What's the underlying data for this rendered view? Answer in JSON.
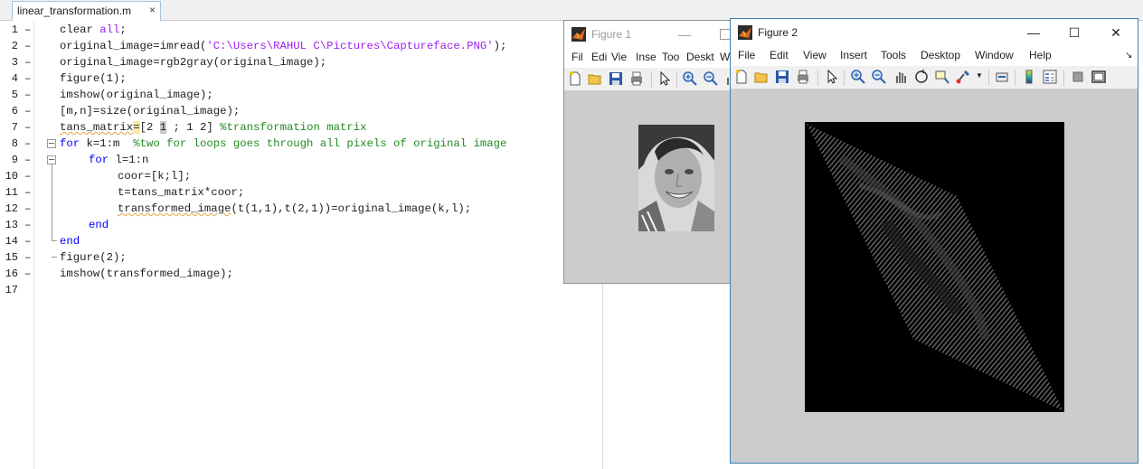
{
  "editor": {
    "tab_label": "linear_transformation.m",
    "tab_close": "×",
    "line_numbers": [
      "1",
      "2",
      "3",
      "4",
      "5",
      "6",
      "7",
      "8",
      "9",
      "10",
      "11",
      "12",
      "13",
      "14",
      "15",
      "16",
      "17"
    ],
    "dash": "–",
    "lines": {
      "l1_a": "clear ",
      "l1_b": "all",
      "l1_c": ";",
      "l2_a": "original_image=imread(",
      "l2_b": "'C:\\Users\\RAHUL C\\Pictures\\Captureface.PNG'",
      "l2_c": ");",
      "l3": "original_image=rgb2gray(original_image);",
      "l4": "figure(1);",
      "l5": "imshow(original_image);",
      "l6": "[m,n]=size(original_image);",
      "l7_a": "tans_matrix",
      "l7_b": "=",
      "l7_c": "[2 ",
      "l7_d": "1",
      "l7_e": " ; 1 2] ",
      "l7_f": "%transformation matrix",
      "l8_a": "for",
      "l8_b": " k=1:m  ",
      "l8_c": "%two for loops goes through all pixels of original image",
      "l9_a": "for",
      "l9_b": " l=1:n",
      "l10": "coor=[k;l];",
      "l11": "t=tans_matrix*coor;",
      "l12_a": "transformed_image",
      "l12_b": "(t(1,1),t(2,1))=original_image(k,l);",
      "l13": "end",
      "l14": "end",
      "l15": "figure(2);",
      "l16": "imshow(transformed_image);"
    }
  },
  "figure1": {
    "title": "Figure 1",
    "menu": [
      "Fil",
      "Edi",
      "Vie",
      "Inse",
      "Too",
      "Deskt",
      "W"
    ],
    "minimize": "—"
  },
  "figure2": {
    "title": "Figure 2",
    "menu": [
      "File",
      "Edit",
      "View",
      "Insert",
      "Tools",
      "Desktop",
      "Window",
      "Help"
    ],
    "minimize": "—",
    "maximize": "☐",
    "close": "✕",
    "dock_arrow": "↘"
  },
  "colors": {
    "keyword": "#0000ff",
    "string": "#a020f0",
    "comment": "#228b22",
    "figure_bg": "#cccccc"
  },
  "icons": [
    "new-figure-icon",
    "open-icon",
    "save-icon",
    "print-icon",
    "pointer-icon",
    "zoom-in-icon",
    "zoom-out-icon",
    "pan-icon",
    "rotate-icon",
    "data-cursor-icon",
    "brush-icon",
    "link-icon",
    "colorbar-icon",
    "legend-icon",
    "hide-plot-tools-icon",
    "show-plot-tools-icon"
  ]
}
